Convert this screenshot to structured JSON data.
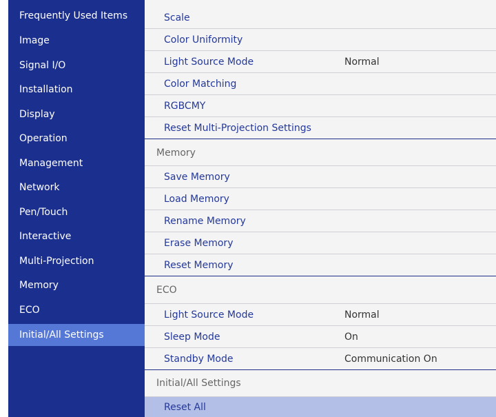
{
  "sidebar": {
    "items": [
      {
        "label": "Frequently Used Items"
      },
      {
        "label": "Image"
      },
      {
        "label": "Signal I/O"
      },
      {
        "label": "Installation"
      },
      {
        "label": "Display"
      },
      {
        "label": "Operation"
      },
      {
        "label": "Management"
      },
      {
        "label": "Network"
      },
      {
        "label": "Pen/Touch"
      },
      {
        "label": "Interactive"
      },
      {
        "label": "Multi-Projection"
      },
      {
        "label": "Memory"
      },
      {
        "label": "ECO"
      },
      {
        "label": "Initial/All Settings"
      }
    ],
    "selected": "Initial/All Settings"
  },
  "main": {
    "rows": [
      {
        "label": "Scale",
        "value": ""
      },
      {
        "label": "Color Uniformity",
        "value": ""
      },
      {
        "label": "Light Source Mode",
        "value": "Normal"
      },
      {
        "label": "Color Matching",
        "value": ""
      },
      {
        "label": "RGBCMY",
        "value": ""
      },
      {
        "label": "Reset Multi-Projection Settings",
        "value": ""
      },
      {
        "label": "Memory",
        "value": ""
      },
      {
        "label": "Save Memory",
        "value": ""
      },
      {
        "label": "Load Memory",
        "value": ""
      },
      {
        "label": "Rename Memory",
        "value": ""
      },
      {
        "label": "Erase Memory",
        "value": ""
      },
      {
        "label": "Reset Memory",
        "value": ""
      },
      {
        "label": "ECO",
        "value": ""
      },
      {
        "label": "Light Source Mode",
        "value": "Normal"
      },
      {
        "label": "Sleep Mode",
        "value": "On"
      },
      {
        "label": "Standby Mode",
        "value": "Communication On"
      },
      {
        "label": "Initial/All Settings",
        "value": ""
      },
      {
        "label": "Reset All",
        "value": ""
      }
    ],
    "selected": "Reset All"
  },
  "colors": {
    "sidebar_bg": "#1a2f8e",
    "sidebar_active": "#5577d6",
    "panel_bg": "#f4f4f4",
    "item_text": "#24389a",
    "selected_row": "#b3bfe6"
  }
}
